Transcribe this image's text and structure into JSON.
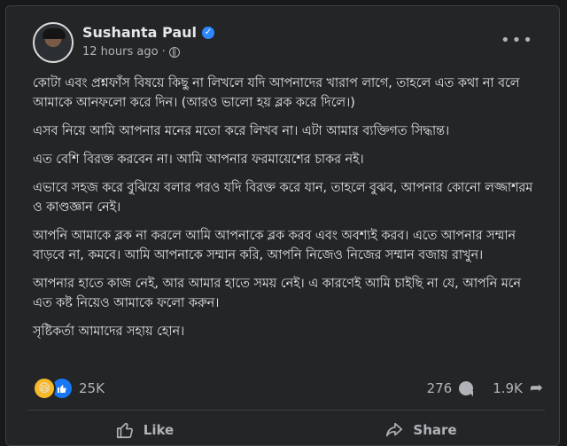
{
  "post": {
    "author": "Sushanta Paul",
    "timestamp": "12 hours ago ·",
    "paragraphs": [
      "কোটা এবং প্রশ্নফাঁস বিষয়ে কিছু না লিখলে যদি আপনাদের খারাপ লাগে, তাহলে এত কথা না বলে আমাকে আনফলো করে দিন। (আরও ভালো হয় ব্লক করে দিলে।)",
      "এসব নিয়ে আমি আপনার মনের মতো করে লিখব না। এটা আমার ব্যক্তিগত সিদ্ধান্ত।",
      "এত বেশি বিরক্ত করবেন না। আমি আপনার ফরমায়েশের চাকর নই।",
      "এভাবে সহজ করে বুঝিয়ে বলার পরও যদি বিরক্ত করে যান, তাহলে বুঝব, আপনার কোনো লজ্জাশরম ও কাণ্ডজ্ঞান নেই।",
      "আপনি আমাকে ব্লক না করলে আমি আপনাকে ব্লক করব এবং অবশ্যই করব। এতে আপনার সম্মান বাড়বে না, কমবে। আমি আপনাকে সম্মান করি, আপনি নিজেও নিজের সম্মান বজায় রাখুন।",
      "আপনার হাতে কাজ নেই, আর আমার হাতে সময় নেই। এ কারণেই আমি চাইছি না যে, আপনি মনে এত কষ্ট নিয়েও আমাকে ফলো করুন।",
      "সৃষ্টিকর্তা আমাদের সহায় হোন।"
    ]
  },
  "stats": {
    "reactions_count": "25K",
    "comments_count": "276",
    "shares_count": "1.9K"
  },
  "actions": {
    "like_label": "Like",
    "share_label": "Share"
  },
  "icons": {
    "reaction_haha": "haha-emoji-icon",
    "reaction_like": "like-thumb-icon",
    "accent": "#2d88ff"
  }
}
